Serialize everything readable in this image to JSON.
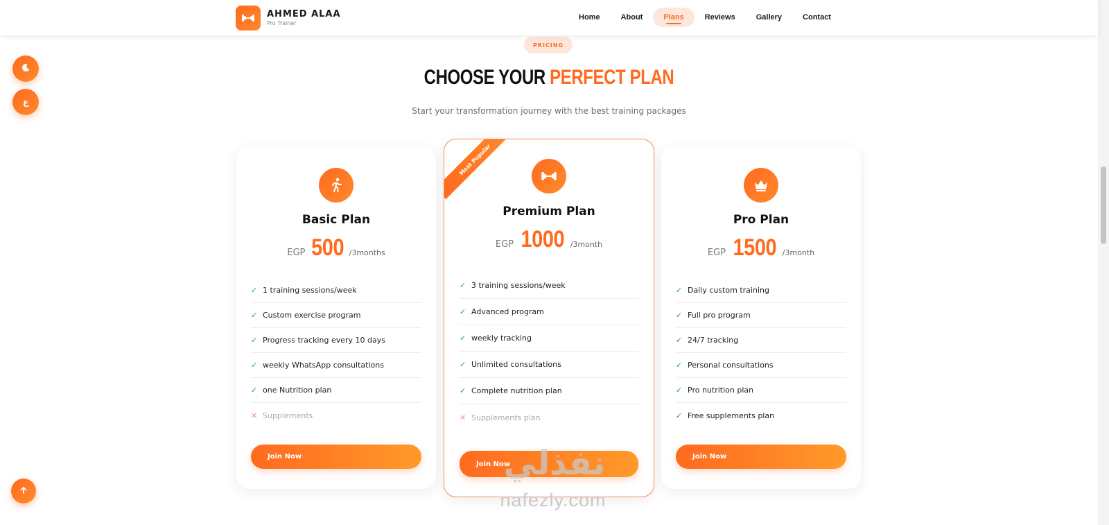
{
  "brand": {
    "name": "AHMED ALAA",
    "tagline": "Pro Trainer"
  },
  "nav": {
    "items": [
      {
        "label": "Home"
      },
      {
        "label": "About"
      },
      {
        "label": "Plans",
        "active": true
      },
      {
        "label": "Reviews"
      },
      {
        "label": "Gallery"
      },
      {
        "label": "Contact"
      }
    ]
  },
  "floating": {
    "theme_icon": "moon-icon",
    "lang_label": "ع",
    "top_icon": "arrow-up-icon"
  },
  "section": {
    "badge": "PRICING",
    "title_dark": "CHOOSE YOUR",
    "title_accent": "PERFECT PLAN",
    "subtitle": "Start your transformation journey with the best training packages"
  },
  "plans": [
    {
      "title": "Basic Plan",
      "icon": "running-icon",
      "currency": "EGP",
      "price": "500",
      "period": "/3months",
      "features": [
        {
          "text": "1 training sessions/week",
          "included": true
        },
        {
          "text": "Custom exercise program",
          "included": true
        },
        {
          "text": "Progress tracking every 10 days",
          "included": true
        },
        {
          "text": "weekly WhatsApp consultations",
          "included": true
        },
        {
          "text": "one Nutrition plan",
          "included": true
        },
        {
          "text": "Supplements",
          "included": false
        }
      ],
      "cta": "Join Now"
    },
    {
      "title": "Premium Plan",
      "icon": "dumbbell-icon",
      "ribbon": "Most Popular",
      "currency": "EGP",
      "price": "1000",
      "period": "/3month",
      "features": [
        {
          "text": "3 training sessions/week",
          "included": true
        },
        {
          "text": "Advanced program",
          "included": true
        },
        {
          "text": "weekly tracking",
          "included": true
        },
        {
          "text": "Unlimited consultations",
          "included": true
        },
        {
          "text": "Complete nutrition plan",
          "included": true
        },
        {
          "text": "Supplements plan",
          "included": false
        }
      ],
      "cta": "Join Now"
    },
    {
      "title": "Pro Plan",
      "icon": "crown-icon",
      "currency": "EGP",
      "price": "1500",
      "period": "/3month",
      "features": [
        {
          "text": "Daily custom training",
          "included": true
        },
        {
          "text": "Full pro program",
          "included": true
        },
        {
          "text": "24/7 tracking",
          "included": true
        },
        {
          "text": "Personal consultations",
          "included": true
        },
        {
          "text": "Pro nutrition plan",
          "included": true
        },
        {
          "text": "Free supplements plan",
          "included": true
        }
      ],
      "cta": "Join Now"
    }
  ],
  "watermark": {
    "arabic": "نفذلي",
    "latin": "nafezly.com"
  },
  "colors": {
    "accent": "#ff6a1f",
    "accent_light": "#fde6dc",
    "check": "#22a55a",
    "cross": "#f0998a"
  }
}
